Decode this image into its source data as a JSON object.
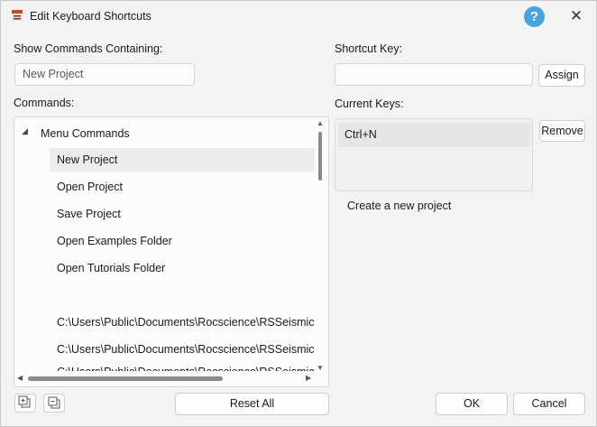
{
  "window": {
    "title": "Edit Keyboard Shortcuts",
    "help_icon": "question-icon",
    "help_glyph": "?",
    "close_glyph": "✕"
  },
  "filter": {
    "label": "Show Commands Containing:",
    "value": "New Project"
  },
  "commands": {
    "label": "Commands:",
    "group": {
      "label": "Menu Commands",
      "expander": "◢"
    },
    "items": [
      "New Project",
      "Open Project",
      "Save Project",
      "Open Examples Folder",
      "Open Tutorials Folder",
      "",
      "C:\\Users\\Public\\Documents\\Rocscience\\RSSeismic Exa",
      "C:\\Users\\Public\\Documents\\Rocscience\\RSSeismic Exa",
      "C:\\Users\\Public\\Documents\\Rocscience\\RSSeismic Exa"
    ],
    "selected_index": 0
  },
  "shortcut": {
    "label": "Shortcut Key:",
    "value": "",
    "assign_label": "Assign"
  },
  "current_keys": {
    "label": "Current Keys:",
    "keys": [
      "Ctrl+N"
    ],
    "remove_label": "Remove",
    "description": "Create a new project"
  },
  "footer": {
    "reset_label": "Reset All",
    "ok_label": "OK",
    "cancel_label": "Cancel"
  },
  "scroll": {
    "up": "▲",
    "down": "▼",
    "left": "◀",
    "right": "▶"
  },
  "colors": {
    "help_blue": "#4aa3df",
    "selected_row": "#ececec"
  }
}
